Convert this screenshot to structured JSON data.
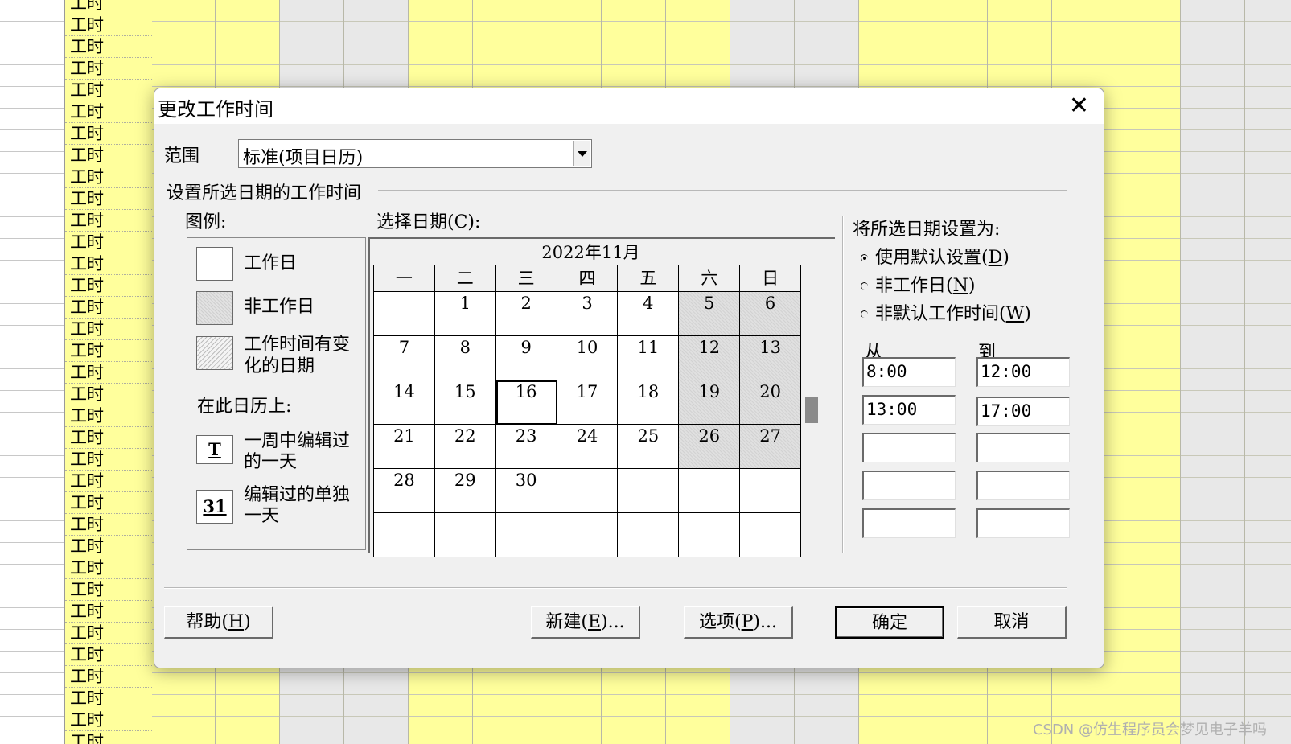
{
  "background": {
    "column_label": "工时",
    "row_count": 35,
    "watermark": "CSDN @仿生程序员会梦见电子羊吗"
  },
  "dialog": {
    "title": "更改工作时间",
    "close_glyph": "✕",
    "scope_label": "范围",
    "scope_value": "标准(项目日历)",
    "section_title": "设置所选日期的工作时间",
    "legend": {
      "title": "图例:",
      "working_day": "工作日",
      "nonworking_day": "非工作日",
      "changed_line1": "工作时间有变",
      "changed_line2": "化的日期",
      "on_calendar": "在此日历上:",
      "edited_week_marker": "T",
      "edited_week_line1": "一周中编辑过",
      "edited_week_line2": "的一天",
      "edited_day_marker": "31",
      "edited_day_line1": "编辑过的单独",
      "edited_day_line2": "一天"
    },
    "select_date_label": "选择日期(C):",
    "calendar": {
      "month_title": "2022年11月",
      "weekdays": [
        "一",
        "二",
        "三",
        "四",
        "五",
        "六",
        "日"
      ],
      "weeks": [
        [
          "",
          "1",
          "2",
          "3",
          "4",
          "5",
          "6"
        ],
        [
          "7",
          "8",
          "9",
          "10",
          "11",
          "12",
          "13"
        ],
        [
          "14",
          "15",
          "16",
          "17",
          "18",
          "19",
          "20"
        ],
        [
          "21",
          "22",
          "23",
          "24",
          "25",
          "26",
          "27"
        ],
        [
          "28",
          "29",
          "30",
          "",
          "",
          "",
          ""
        ],
        [
          "",
          "",
          "",
          "",
          "",
          "",
          ""
        ]
      ],
      "selected_day": "16",
      "weekend_columns": [
        5,
        6
      ]
    },
    "set_as": {
      "title": "将所选日期设置为:",
      "options": [
        {
          "text": "使用默认设置(",
          "key": "D",
          "tail": ")",
          "checked": true
        },
        {
          "text": "非工作日(",
          "key": "N",
          "tail": ")",
          "checked": false
        },
        {
          "text": "非默认工作时间(",
          "key": "W",
          "tail": ")",
          "checked": false
        }
      ],
      "from_label": "从",
      "to_label": "到",
      "from_values": [
        "8:00",
        "13:00",
        "",
        "",
        ""
      ],
      "to_values": [
        "12:00",
        "17:00",
        "",
        "",
        ""
      ]
    },
    "buttons": {
      "help": {
        "text": "帮助(",
        "key": "H",
        "tail": ")"
      },
      "new": {
        "text": "新建(",
        "key": "E",
        "tail": ")..."
      },
      "options": {
        "text": "选项(",
        "key": "P",
        "tail": ")..."
      },
      "ok": "确定",
      "cancel": "取消"
    }
  }
}
